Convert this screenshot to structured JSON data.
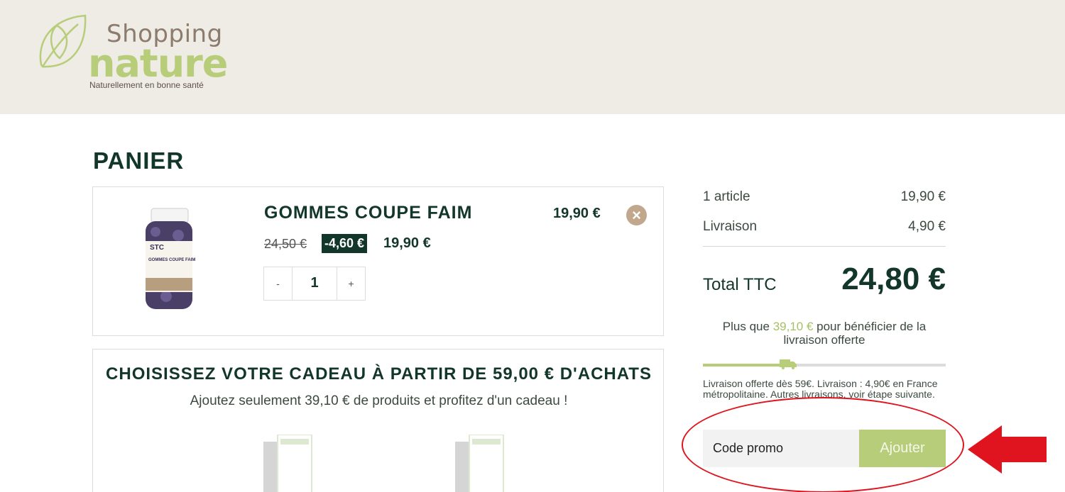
{
  "header": {
    "logo_top": "Shopping",
    "logo_main": "nature",
    "tagline": "Naturellement en bonne santé"
  },
  "page": {
    "title": "PANIER"
  },
  "cart_item": {
    "name": "GOMMES COUPE FAIM",
    "old_price": "24,50 €",
    "discount": "-4,60 €",
    "unit_price": "19,90 €",
    "line_price": "19,90 €",
    "quantity": "1",
    "qty_minus": "-",
    "qty_plus": "+",
    "remove_icon": "close-icon",
    "image_label_brand": "STC",
    "image_label_text": "GOMMES COUPE FAIM"
  },
  "gift": {
    "title": "CHOISISSEZ VOTRE CADEAU À PARTIR DE 59,00 € D'ACHATS",
    "subtitle": "Ajoutez seulement 39,10 € de produits et profitez d'un cadeau !"
  },
  "summary": {
    "items_label": "1 article",
    "items_value": "19,90 €",
    "shipping_label": "Livraison",
    "shipping_value": "4,90 €",
    "total_label": "Total TTC",
    "total_value": "24,80 €",
    "free_msg_before": "Plus que ",
    "free_msg_amount": "39,10 €",
    "free_msg_after": " pour bénéficier de la livraison offerte",
    "free_shipping_progress": 0.337,
    "shipping_note": "Livraison offerte dès 59€. Livraison : 4,90€ en France métropolitaine. Autres livraisons, voir étape suivante.",
    "promo_placeholder": "Code promo",
    "promo_button": "Ajouter"
  },
  "colors": {
    "header_bg": "#efebe5",
    "dark_green": "#12372a",
    "accent_green": "#b7cd7a",
    "remove_btn": "#c2a78c",
    "annotation_red": "#e0141e"
  }
}
